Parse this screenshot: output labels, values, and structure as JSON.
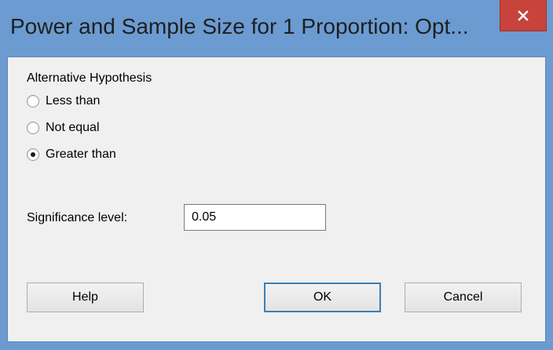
{
  "window": {
    "title": "Power and Sample Size for 1 Proportion: Opt...",
    "close_icon": "close-icon",
    "titlebar_color": "#6b9bd1",
    "close_color": "#c7433b"
  },
  "hypothesis": {
    "label": "Alternative Hypothesis",
    "options": [
      {
        "label": "Less than",
        "checked": false
      },
      {
        "label": "Not equal",
        "checked": false
      },
      {
        "label": "Greater than",
        "checked": true
      }
    ]
  },
  "significance": {
    "label": "Significance level:",
    "value": "0.05"
  },
  "buttons": {
    "help": "Help",
    "ok": "OK",
    "cancel": "Cancel"
  }
}
